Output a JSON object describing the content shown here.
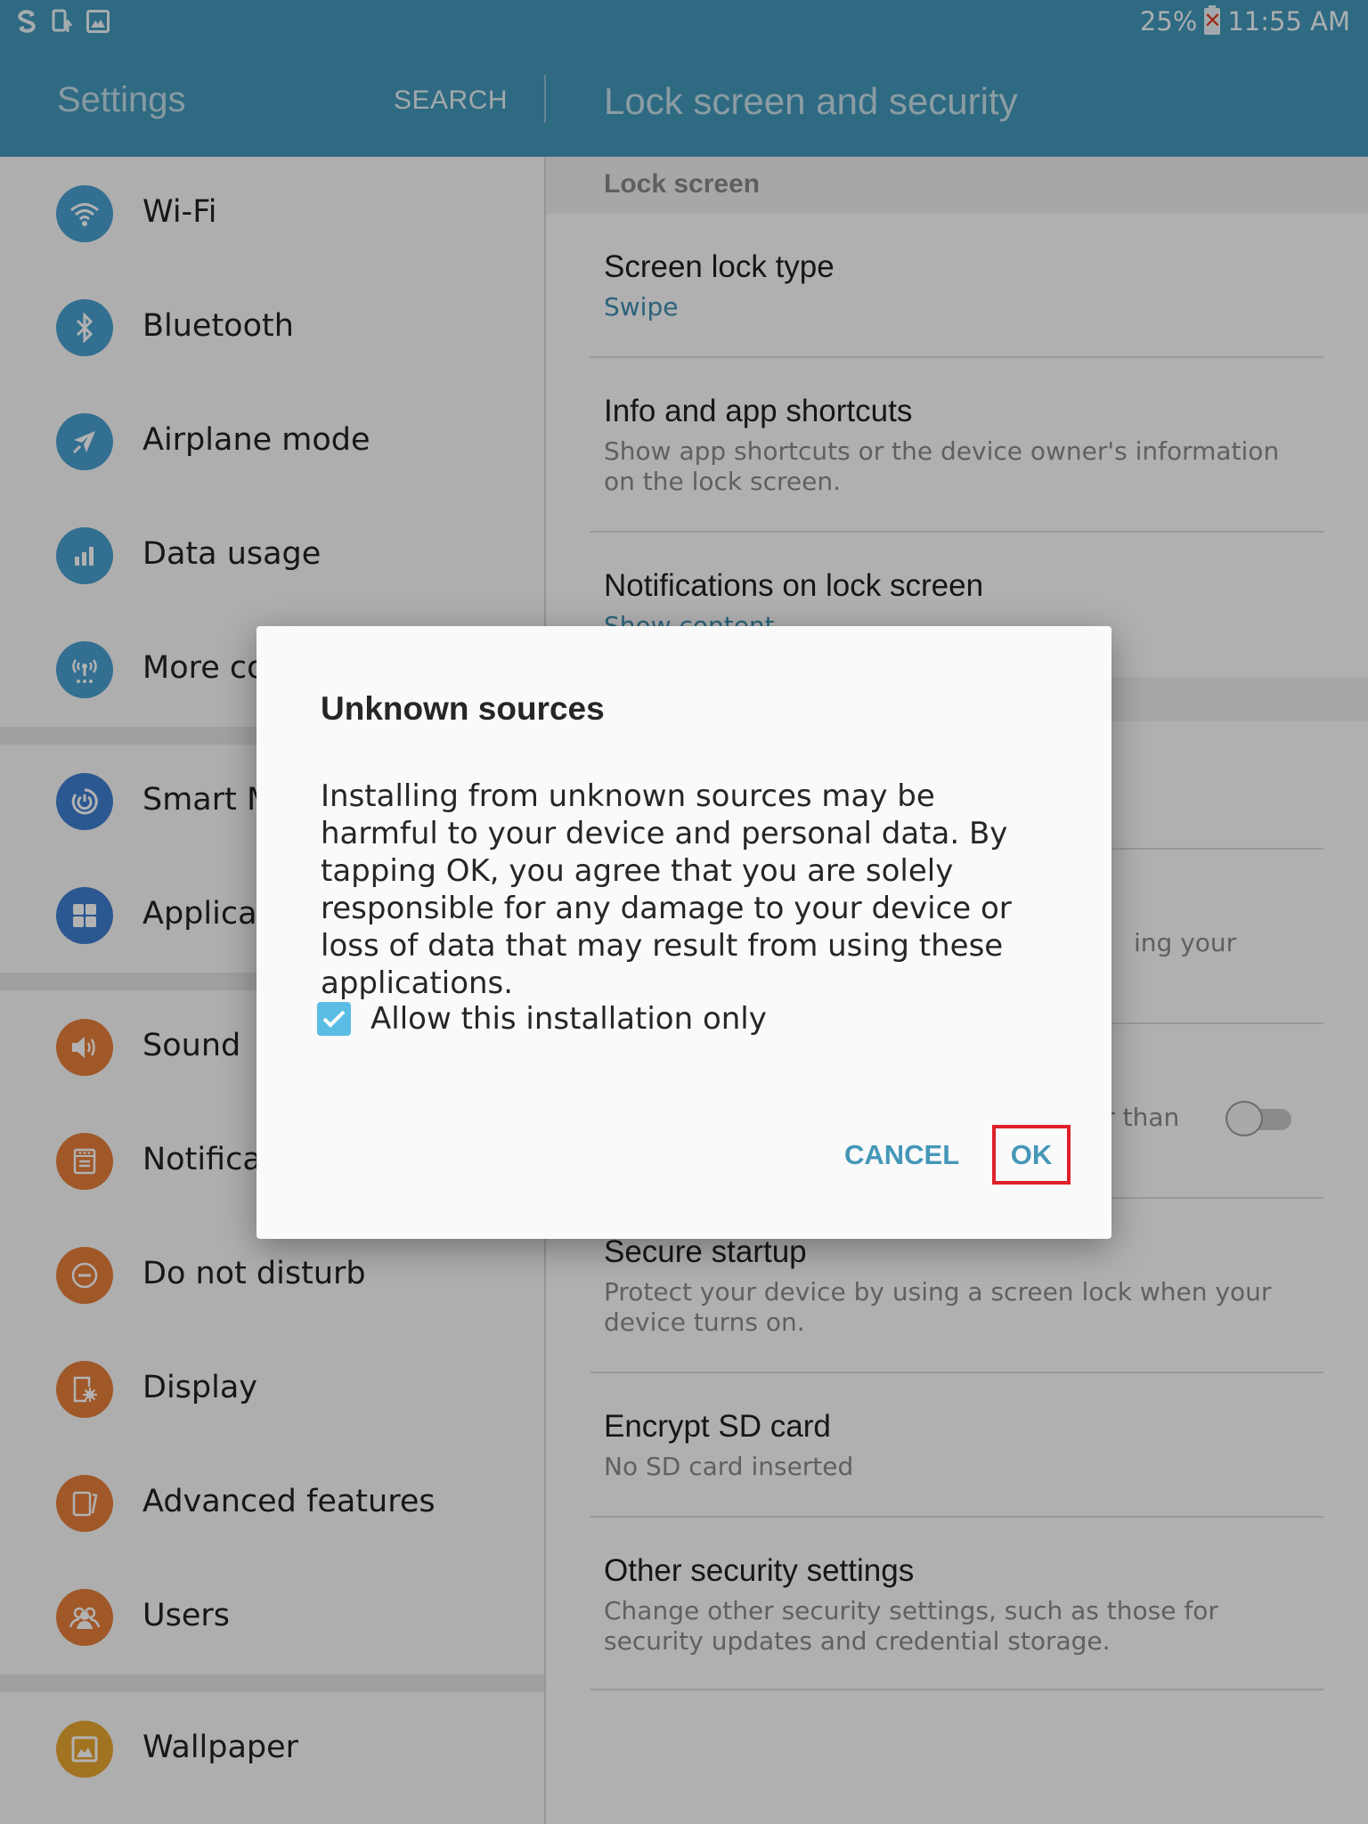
{
  "status_bar": {
    "left_icons": [
      "sync-s-icon",
      "device-upload-icon",
      "gallery-image-icon"
    ],
    "battery_percent": "25%",
    "battery_icon": "battery-error-icon",
    "time": "11:55 AM"
  },
  "header": {
    "app_title": "Settings",
    "search_label": "SEARCH",
    "page_title": "Lock screen and security"
  },
  "colors": {
    "header_bg": "#4398ba",
    "accent_blue": "#4597b8",
    "checkbox": "#5bbde3",
    "highlight_box": "#e0202b",
    "connections_icon": "#4a9fd0",
    "device_icon": "#3f7ed0",
    "personal_icon": "#e67e3b",
    "wallpaper_icon": "#e8a52e"
  },
  "sidebar": {
    "items": [
      {
        "label": "Wi-Fi",
        "icon": "wifi-icon",
        "group": "connections"
      },
      {
        "label": "Bluetooth",
        "icon": "bluetooth-icon",
        "group": "connections"
      },
      {
        "label": "Airplane mode",
        "icon": "airplane-icon",
        "group": "connections"
      },
      {
        "label": "Data usage",
        "icon": "data-usage-icon",
        "group": "connections"
      },
      {
        "label": "More connection settings",
        "icon": "antenna-icon",
        "group": "connections"
      },
      {
        "label": "Smart Manager",
        "icon": "smart-manager-icon",
        "group": "device"
      },
      {
        "label": "Applications",
        "icon": "applications-grid-icon",
        "group": "device"
      },
      {
        "label": "Sound",
        "icon": "speaker-icon",
        "group": "personal"
      },
      {
        "label": "Notifications",
        "icon": "notifications-icon",
        "group": "personal"
      },
      {
        "label": "Do not disturb",
        "icon": "do-not-disturb-icon",
        "group": "personal"
      },
      {
        "label": "Display",
        "icon": "display-icon",
        "group": "personal"
      },
      {
        "label": "Advanced features",
        "icon": "advanced-features-icon",
        "group": "personal"
      },
      {
        "label": "Users",
        "icon": "users-icon",
        "group": "personal"
      },
      {
        "label": "Wallpaper",
        "icon": "wallpaper-icon",
        "group": "wallpaper"
      }
    ]
  },
  "content": {
    "section_lock_screen": "Lock screen",
    "rows": [
      {
        "title": "Screen lock type",
        "subtitle": "Swipe",
        "subtitle_style": "value"
      },
      {
        "title": "Info and app shortcuts",
        "subtitle": "Show app shortcuts or the device owner's information on the lock screen.",
        "subtitle_style": "description"
      },
      {
        "title": "Notifications on lock screen",
        "subtitle": "Show content",
        "subtitle_style": "value"
      },
      {
        "title": "",
        "subtitle": "ing your",
        "subtitle_style": "description"
      },
      {
        "title": "",
        "subtitle": "er than",
        "subtitle_style": "description",
        "toggle_on": false
      },
      {
        "title": "Secure startup",
        "subtitle": "Protect your device by using a screen lock when your device turns on.",
        "subtitle_style": "description"
      },
      {
        "title": "Encrypt SD card",
        "subtitle": "No SD card inserted",
        "subtitle_style": "description"
      },
      {
        "title": "Other security settings",
        "subtitle": "Change other security settings, such as those for security updates and credential storage.",
        "subtitle_style": "description"
      }
    ]
  },
  "dialog": {
    "title": "Unknown sources",
    "body": "Installing from unknown sources may be harmful to your device and personal data. By tapping OK, you agree that you are solely responsible for any damage to your device or loss of data that may result from using these applications.",
    "checkbox_label": "Allow this installation only",
    "checkbox_checked": true,
    "cancel_label": "CANCEL",
    "ok_label": "OK"
  }
}
